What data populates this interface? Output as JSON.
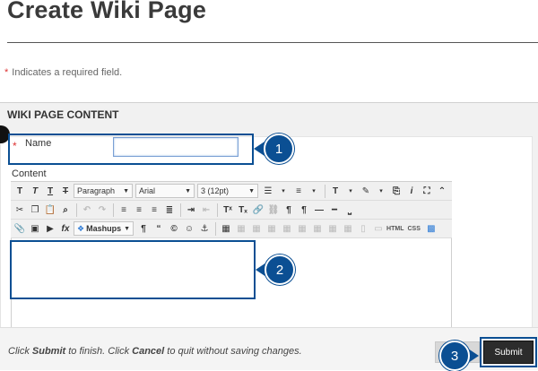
{
  "page_title": "Create Wiki Page",
  "required_note": {
    "star": "*",
    "text": "Indicates a required field."
  },
  "section_heading": "WIKI PAGE CONTENT",
  "name_field": {
    "star": "*",
    "label": "Name",
    "value": ""
  },
  "content_label": "Content",
  "editor": {
    "format_select": "Paragraph",
    "font_select": "Arial",
    "size_select": "3 (12pt)",
    "mashups_label": "Mashups",
    "html_label": "HTML",
    "css_label": "CSS"
  },
  "callouts": [
    "1",
    "2",
    "3"
  ],
  "footer": {
    "part1": "Click ",
    "submit_word": "Submit",
    "part2": " to finish. Click ",
    "cancel_word": "Cancel",
    "part3": " to quit without saving changes."
  },
  "submit_label": "Submit",
  "colors": {
    "callout": "#0b4f93",
    "submit_bg": "#2c2c2c",
    "required": "#dd3333"
  }
}
